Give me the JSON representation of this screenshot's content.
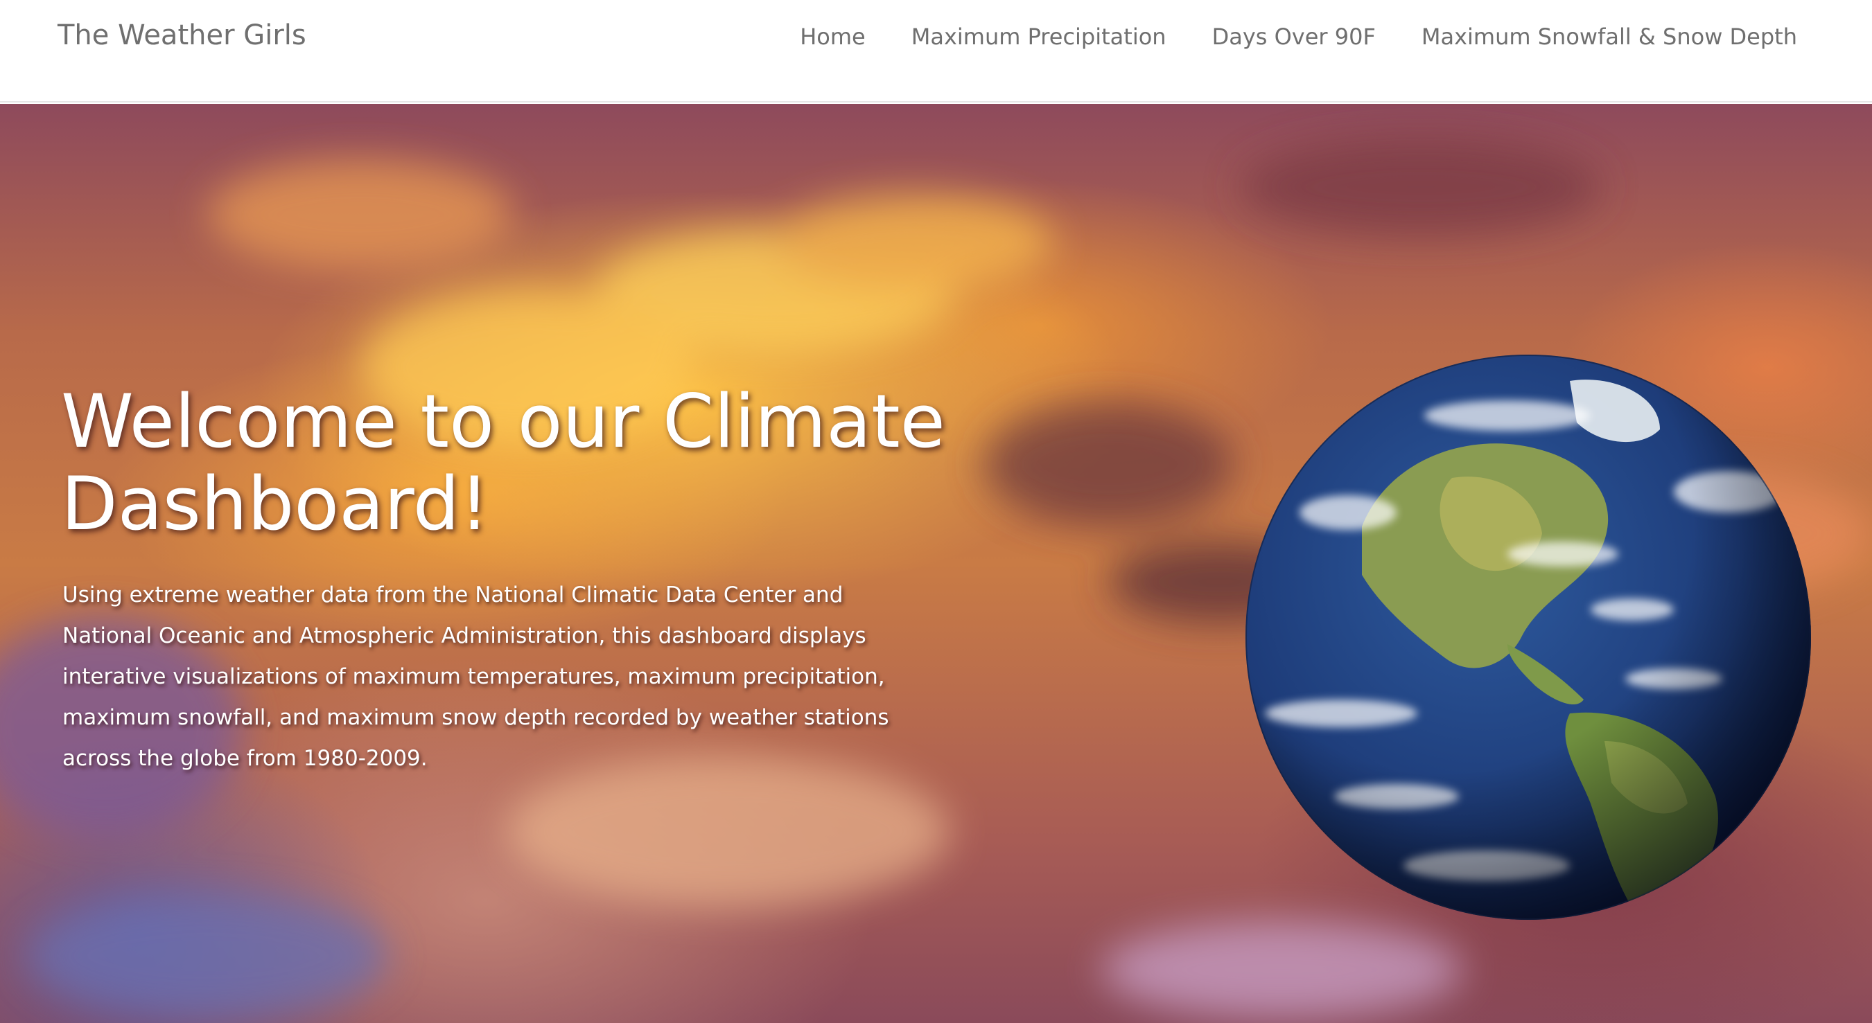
{
  "nav": {
    "brand": "The Weather Girls",
    "links": [
      {
        "label": "Home"
      },
      {
        "label": "Maximum Precipitation"
      },
      {
        "label": "Days Over 90F"
      },
      {
        "label": "Maximum Snowfall & Snow Depth"
      }
    ]
  },
  "hero": {
    "title": "Welcome to our Climate Dashboard!",
    "description": "Using extreme weather data from the National Climatic Data Center and National Oceanic and Atmospheric Administration, this dashboard displays interative visualizations of maximum temperatures, maximum precipitation, maximum snowfall, and maximum snow depth recorded by weather stations across the globe from 1980-2009.",
    "background": "sunset-storm-clouds",
    "image": "earth-globe"
  },
  "colors": {
    "nav_text": "#6f6f6f",
    "hero_text": "#ffffff",
    "ocean": "#1f3f7a",
    "land": "#7f9a4a"
  }
}
